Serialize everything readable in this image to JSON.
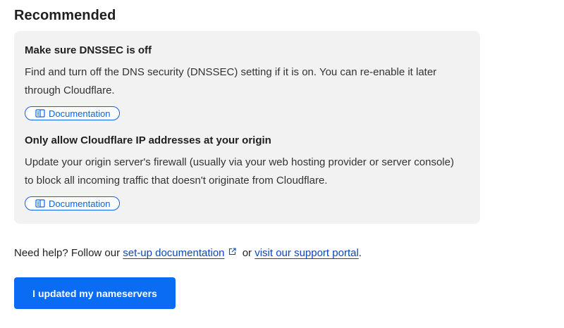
{
  "section": {
    "title": "Recommended"
  },
  "recommendations": [
    {
      "heading": "Make sure DNSSEC is off",
      "body": "Find and turn off the DNS security (DNSSEC) setting if it is on. You can re-enable it later through Cloudflare.",
      "button_label": "Documentation",
      "button_icon": "book-icon"
    },
    {
      "heading": "Only allow Cloudflare IP addresses at your origin",
      "body": "Update your origin server's firewall (usually via your web hosting provider or server console) to block all incoming traffic that doesn't originate from Cloudflare.",
      "button_label": "Documentation",
      "button_icon": "book-icon"
    }
  ],
  "help": {
    "prefix": "Need help? Follow our ",
    "setup_link": "set-up documentation",
    "setup_link_icon": "external-link-icon",
    "middle": " or ",
    "support_link": "visit our support portal",
    "suffix": "."
  },
  "primary_action": {
    "label": "I updated my nameservers"
  },
  "colors": {
    "accent": "#0a6cf2",
    "link": "#0a47b8",
    "card_background": "#f2f2f2"
  }
}
